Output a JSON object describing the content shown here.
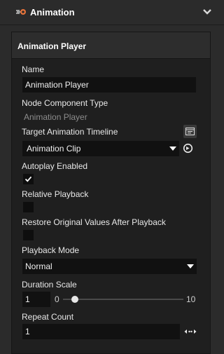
{
  "header": {
    "title": "Animation",
    "icon": "animation-component-icon",
    "chevron": "chevron-down-icon"
  },
  "panel": {
    "title": "Animation Player",
    "name": {
      "label": "Name",
      "value": "Animation Player"
    },
    "node_component_type": {
      "label": "Node Component Type",
      "value": "Animation Player"
    },
    "target_timeline": {
      "label": "Target Animation Timeline",
      "value": "Animation Clip",
      "timeline_icon": "timeline-editor-icon",
      "goto_icon": "go-to-arrow-icon"
    },
    "autoplay": {
      "label": "Autoplay Enabled",
      "checked": true
    },
    "relative_playback": {
      "label": "Relative Playback",
      "checked": false
    },
    "restore_values": {
      "label": "Restore Original Values After Playback",
      "checked": false
    },
    "playback_mode": {
      "label": "Playback Mode",
      "value": "Normal"
    },
    "duration_scale": {
      "label": "Duration Scale",
      "value": "1",
      "min": "0",
      "max": "10",
      "slider_value": 1
    },
    "repeat_count": {
      "label": "Repeat Count",
      "value": "1",
      "infinite_icon": "infinite-repeat-icon"
    }
  },
  "colors": {
    "background": "#2b2b2b",
    "panel": "#1f1f1f",
    "field": "#111111",
    "accent_orange": "#e8743b"
  }
}
